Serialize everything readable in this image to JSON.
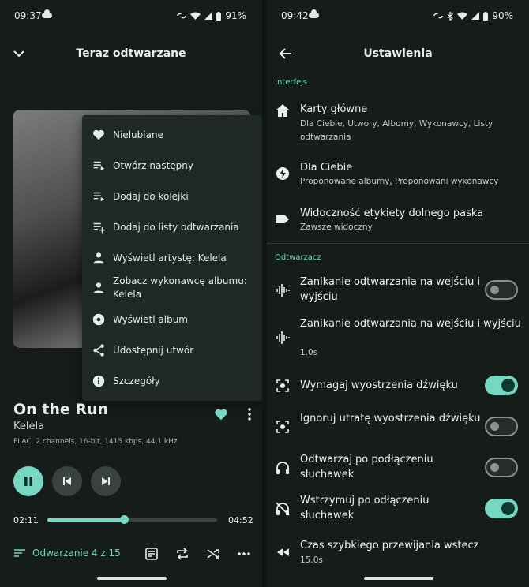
{
  "left": {
    "status": {
      "time": "09:37",
      "battery": "91%"
    },
    "appbar": {
      "title": "Teraz odtwarzane"
    },
    "menu": [
      {
        "icon": "heart-icon",
        "label": "Nielubiane"
      },
      {
        "icon": "play-next-icon",
        "label": "Otwórz następny"
      },
      {
        "icon": "queue-add-icon",
        "label": "Dodaj do kolejki"
      },
      {
        "icon": "playlist-add-icon",
        "label": "Dodaj do listy odtwarzania"
      },
      {
        "icon": "person-icon",
        "label": "Wyświetl artystę: Kelela"
      },
      {
        "icon": "person-icon",
        "label": "Zobacz wykonawcę albumu: Kelela"
      },
      {
        "icon": "album-icon",
        "label": "Wyświetl album"
      },
      {
        "icon": "share-icon",
        "label": "Udostępnij utwór"
      },
      {
        "icon": "info-icon",
        "label": "Szczegóły"
      }
    ],
    "track": {
      "title": "On the Run",
      "artist": "Kelela",
      "meta": "FLAC, 2 channels, 16-bit, 1415 kbps, 44.1 kHz",
      "current": "02:11",
      "total": "04:52",
      "progress": 0.45
    },
    "queue_label": "Odwarzanie 4 z 15",
    "accent": "#76d8c3"
  },
  "right": {
    "status": {
      "time": "09:42",
      "battery": "90%"
    },
    "appbar": {
      "title": "Ustawienia"
    },
    "section_interface": "Interfejs",
    "interface": [
      {
        "icon": "home-icon",
        "title": "Karty główne",
        "subtitle": "Dla Ciebie, Utwory, Albumy, Wykonawcy, Listy odtwarzania"
      },
      {
        "icon": "for-you-icon",
        "title": "Dla Ciebie",
        "subtitle": "Proponowane albumy, Proponowani wykonawcy"
      },
      {
        "icon": "label-icon",
        "title": "Widoczność etykiety dolnego paska",
        "subtitle": "Zawsze widoczny"
      }
    ],
    "section_player": "Odtwarzacz",
    "player": [
      {
        "icon": "waveform-icon",
        "title": "Zanikanie odtwarzania na wejściu i wyjściu",
        "subtitle": "",
        "switch": "off"
      },
      {
        "icon": "waveform-icon",
        "title": "Zanikanie odtwarzania na wejściu i wyjściu",
        "subtitle": "1.0s",
        "switch": ""
      },
      {
        "icon": "focus-icon",
        "title": "Wymagaj wyostrzenia dźwięku",
        "subtitle": "",
        "switch": "on"
      },
      {
        "icon": "focus-icon",
        "title": "Ignoruj utratę wyostrzenia dźwięku",
        "subtitle": "",
        "switch": "off"
      },
      {
        "icon": "headphones-icon",
        "title": "Odtwarzaj po podłączeniu słuchawek",
        "subtitle": "",
        "switch": "off"
      },
      {
        "icon": "headphones-off-icon",
        "title": "Wstrzymuj po odłączeniu słuchawek",
        "subtitle": "",
        "switch": "on"
      },
      {
        "icon": "rewind-icon",
        "title": "Czas szybkiego przewijania wstecz",
        "subtitle": "15.0s",
        "switch": ""
      }
    ]
  }
}
